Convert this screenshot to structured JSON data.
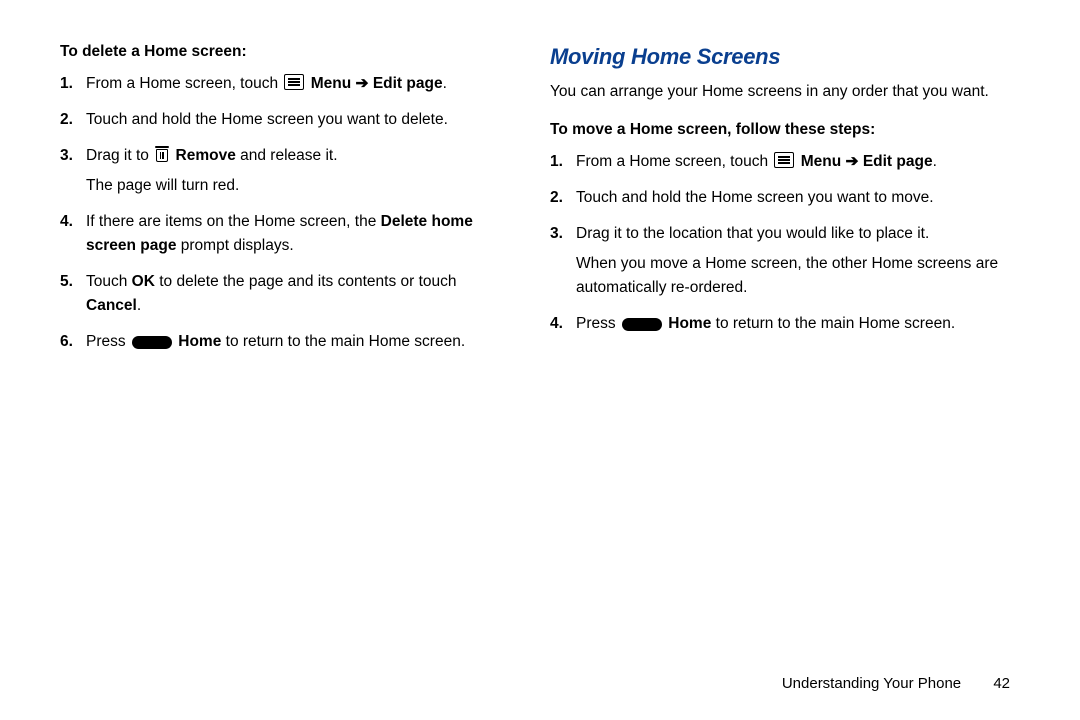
{
  "left": {
    "heading": "To delete a Home screen:",
    "steps": {
      "s1a": "From a Home screen, touch ",
      "menu_bold": "Menu",
      "arrow": " ➔ ",
      "edit_page_bold": "Edit page",
      "s1b": ".",
      "s2": "Touch and hold the Home screen you want to delete.",
      "s3a": "Drag it to ",
      "remove_bold": "Remove",
      "s3b": " and release it.",
      "s3c": "The page will turn red.",
      "s4a": "If there are items on the Home screen, the ",
      "s4bold": "Delete home screen page",
      "s4b": " prompt displays.",
      "s5a": "Touch ",
      "ok_bold": "OK",
      "s5b": " to delete the page and its contents or touch ",
      "cancel_bold": "Cancel",
      "s5c": ".",
      "s6a": "Press ",
      "home_bold": "Home",
      "s6b": " to return to the main Home screen."
    }
  },
  "right": {
    "title": "Moving Home Screens",
    "intro": "You can arrange your Home screens in any order that you want.",
    "heading": "To move a Home screen, follow these steps:",
    "steps": {
      "s1a": "From a Home screen, touch ",
      "menu_bold": "Menu",
      "arrow": " ➔ ",
      "edit_page_bold": "Edit page",
      "s1b": ".",
      "s2": "Touch and hold the Home screen you want to move.",
      "s3a": "Drag it to the location that you would like to place it.",
      "s3b": "When you move a Home screen, the other Home screens are automatically re-ordered.",
      "s4a": "Press ",
      "home_bold": "Home",
      "s4b": " to return to the main Home screen."
    }
  },
  "footer": {
    "section": "Understanding Your Phone",
    "page": "42"
  }
}
